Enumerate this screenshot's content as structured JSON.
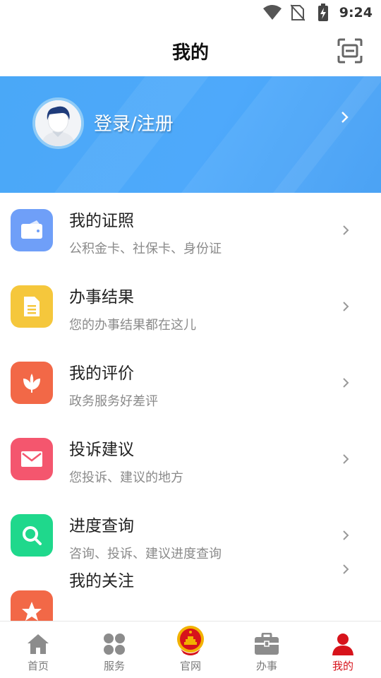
{
  "status_bar": {
    "time": "9:24",
    "icons": [
      "wifi-icon",
      "no-sim-icon",
      "battery-charging-icon"
    ]
  },
  "header": {
    "title": "我的",
    "scan_icon": "scan-icon"
  },
  "profile": {
    "login_label": "登录/注册",
    "avatar_icon": "avatar-icon"
  },
  "menu": [
    {
      "title": "我的证照",
      "subtitle": "公积金卡、社保卡、身份证",
      "icon": "wallet-icon",
      "color": "#6f9ff8"
    },
    {
      "title": "办事结果",
      "subtitle": "您的办事结果都在这儿",
      "icon": "document-icon",
      "color": "#f5c73c"
    },
    {
      "title": "我的评价",
      "subtitle": "政务服务好差评",
      "icon": "flower-icon",
      "color": "#f26847"
    },
    {
      "title": "投诉建议",
      "subtitle": "您投诉、建议的地方",
      "icon": "mail-icon",
      "color": "#f4566e"
    },
    {
      "title": "进度查询",
      "subtitle": "咨询、投诉、建议进度查询",
      "icon": "search-icon",
      "color": "#1fd88c"
    },
    {
      "title": "我的关注",
      "subtitle": "",
      "icon": "star-icon",
      "color": "#f26847"
    }
  ],
  "tabs": [
    {
      "label": "首页",
      "icon": "home-icon",
      "active": false
    },
    {
      "label": "服务",
      "icon": "grid-icon",
      "active": false
    },
    {
      "label": "官网",
      "icon": "national-emblem-icon",
      "active": false
    },
    {
      "label": "办事",
      "icon": "briefcase-icon",
      "active": false
    },
    {
      "label": "我的",
      "icon": "person-icon",
      "active": true
    }
  ],
  "colors": {
    "banner": "#4aa8f7",
    "active_tab": "#d7131b",
    "inactive_tab": "#7a7a7a"
  }
}
